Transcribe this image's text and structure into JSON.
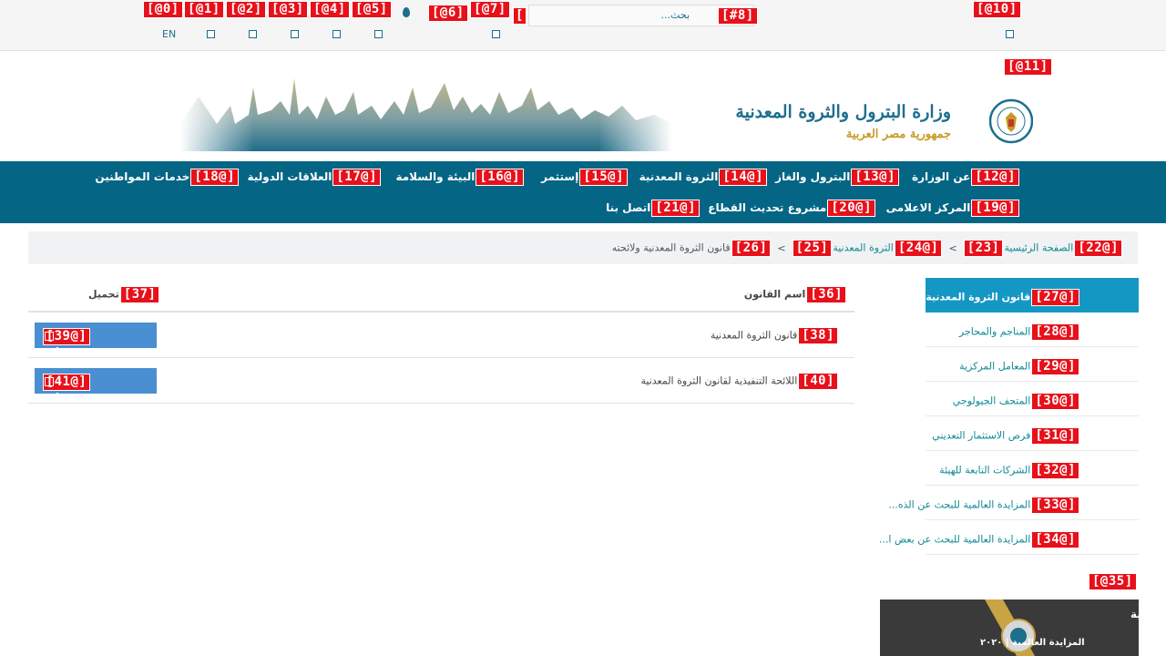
{
  "topbar": {
    "lang_en": "EN",
    "search_placeholder": "بحث...",
    "tags": [
      "[@0]",
      "[@1]",
      "[@2]",
      "[@3]",
      "[@4]",
      "[@5]",
      "[@6]",
      "[@7]",
      "[#8]",
      "[@10]"
    ]
  },
  "header": {
    "ministry_name": "وزارة البترول والثروة المعدنية",
    "country_name": "جمهورية مصر العربية",
    "tag_11": "[@11]"
  },
  "nav": {
    "row1": [
      {
        "tag": "[@12]",
        "label": "عن الوزارة"
      },
      {
        "tag": "[@13]",
        "label": "البترول والغاز"
      },
      {
        "tag": "[@14]",
        "label": "الثروة المعدنية"
      },
      {
        "tag": "[@15]",
        "label": "إستثمر"
      },
      {
        "tag": "[@16]",
        "label": "البيئة والسلامة"
      },
      {
        "tag": "[@17]",
        "label": "العلاقات الدولية"
      },
      {
        "tag": "[@18]",
        "label": "خدمات المواطنين"
      }
    ],
    "row2": [
      {
        "tag": "[@19]",
        "label": "المركز الاعلامى"
      },
      {
        "tag": "[@20]",
        "label": "مشروع تحديث القطاع"
      },
      {
        "tag": "[@21]",
        "label": "اتصل بنا"
      }
    ]
  },
  "breadcrumb": {
    "tag_home": "[@22]",
    "home": "الصفحة الرئيسية",
    "tag_23": "[23]",
    "sep": ">",
    "tag_mineral": "[@24]",
    "mineral": "الثروة المعدنية",
    "tag_25": "[25]",
    "tag_26": "[26]",
    "current": "قانون الثروة المعدنية ولائحته"
  },
  "table": {
    "tag_col_name": "[36]",
    "col_name": "اسم القانون",
    "tag_col_dl": "[37]",
    "col_dl": "تحميل",
    "rows": [
      {
        "tag_name": "[38]",
        "name": "قانون الثروة المعدنية",
        "tag_btn": "[@39]",
        "btn": "تحميل"
      },
      {
        "tag_name": "[40]",
        "name": "اللائحة التنفيذية لقانون الثروة المعدنية",
        "tag_btn": "[@41]",
        "btn": "تحميل"
      }
    ]
  },
  "sidebar": {
    "items": [
      {
        "tag": "[@27]",
        "label": "قانون الثروة المعدنية ولائحته"
      },
      {
        "tag": "[@28]",
        "label": "المناجم والمحاجر"
      },
      {
        "tag": "[@29]",
        "label": "المعامل المركزية"
      },
      {
        "tag": "[@30]",
        "label": "المتحف الجيولوجي"
      },
      {
        "tag": "[@31]",
        "label": "فرص الاستثمار التعديني"
      },
      {
        "tag": "[@32]",
        "label": "الشركات التابعة للهيئة"
      },
      {
        "tag": "[@33]",
        "label": "المزايدة العالمية للبحث عن الذه..."
      },
      {
        "tag": "[@34]",
        "label": "المزايدة العالمية للبحث عن بعض ا..."
      }
    ],
    "tag_35": "[@35]"
  },
  "banner": {
    "title": "هيئة الثروة المعدنية",
    "subtitle": "المزايدة العالمية | ٢٠٢٠"
  },
  "colors": {
    "nav_bg": "#046584",
    "accent": "#1597c4",
    "link": "#0e8a96",
    "button": "#4a8fd1",
    "tag": "#e8101a"
  }
}
